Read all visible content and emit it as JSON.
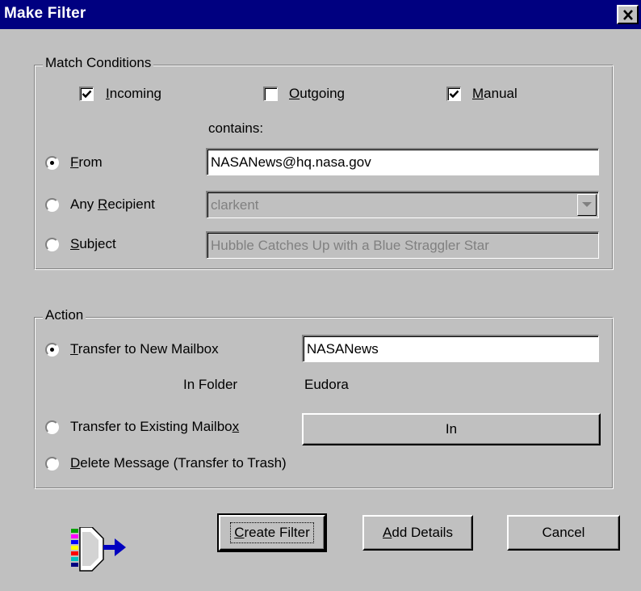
{
  "window": {
    "title": "Make Filter",
    "close_glyph": "×"
  },
  "match": {
    "legend": "Match Conditions",
    "incoming": {
      "label_pre": "",
      "accel": "I",
      "label_post": "ncoming",
      "checked": true
    },
    "outgoing": {
      "label_pre": "",
      "accel": "O",
      "label_post": "utgoing",
      "checked": false
    },
    "manual": {
      "label_pre": "",
      "accel": "M",
      "label_post": "anual",
      "checked": true
    },
    "contains_label": "contains:",
    "from": {
      "accel": "F",
      "label_post": "rom",
      "selected": true,
      "value": "NASANews@hq.nasa.gov"
    },
    "recipient": {
      "label_pre": "Any ",
      "accel": "R",
      "label_post": "ecipient",
      "selected": false,
      "value": "clarkent"
    },
    "subject": {
      "accel": "S",
      "label_post": "ubject",
      "selected": false,
      "value": "Hubble Catches Up with a Blue Straggler Star"
    }
  },
  "action": {
    "legend": "Action",
    "new_mailbox": {
      "accel": "T",
      "label_post": "ransfer to New Mailbox",
      "selected": true,
      "value": "NASANews"
    },
    "in_folder_label": "In Folder",
    "in_folder_value": "Eudora",
    "existing_mailbox": {
      "label_pre": "Transfer to Existing Mailbo",
      "accel": "x",
      "label_post": "",
      "selected": false,
      "button_label": "In"
    },
    "delete": {
      "accel": "D",
      "label_post": "elete Message (Transfer to Trash)",
      "selected": false
    }
  },
  "buttons": {
    "create": {
      "accel": "C",
      "label_post": "reate Filter"
    },
    "details": {
      "accel": "A",
      "label_post": "dd Details"
    },
    "cancel": {
      "label": "Cancel"
    }
  },
  "icons": {
    "filter": "filter-transfer-icon",
    "close": "close-icon",
    "dropdown": "chevron-down-icon"
  }
}
